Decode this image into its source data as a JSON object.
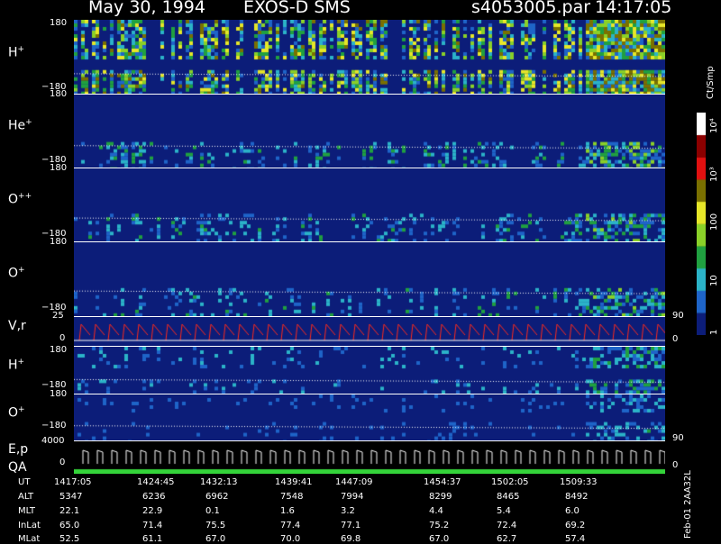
{
  "header": {
    "date": "May 30, 1994",
    "instrument": "EXOS-D SMS",
    "file": "s4053005.par",
    "time": "14:17:05"
  },
  "colorbar": {
    "unit": "Ct/Smp",
    "ticks": [
      "1",
      "10",
      "100",
      "10³",
      "10⁴"
    ],
    "colors": [
      "#0c1d79",
      "#1e64c8",
      "#2bb3c8",
      "#20a040",
      "#8ad028",
      "#e6e628",
      "#7a7000",
      "#e01010",
      "#8b0000",
      "#ffffff"
    ]
  },
  "footer_label": "Feb-01 2AA32L",
  "panels": [
    {
      "name": "H",
      "sup": "+",
      "ytop": "180",
      "ybot": "−180"
    },
    {
      "name": "He",
      "sup": "+",
      "ytop": "180",
      "ybot": "−180"
    },
    {
      "name": "O",
      "sup": "++",
      "ytop": "180",
      "ybot": "−180"
    },
    {
      "name": "O",
      "sup": "+",
      "ytop": "180",
      "ybot": "−180"
    },
    {
      "name": "V,r",
      "sup": "",
      "ytop": "25",
      "ybot": "0",
      "rtop": "90",
      "rbot": "0"
    },
    {
      "name": "H",
      "sup": "+",
      "ytop": "180",
      "ybot": "−180"
    },
    {
      "name": "O",
      "sup": "+",
      "ytop": "180",
      "ybot": "−180"
    },
    {
      "name": "E,p",
      "sup": "",
      "ytop": "4000",
      "ybot": "",
      "rtop": "90",
      "rbot": ""
    },
    {
      "name": "QA",
      "sup": "",
      "ytop": "0",
      "ybot": "",
      "rtop": "0",
      "rbot": ""
    }
  ],
  "ephemeris": {
    "rows": [
      {
        "label": "UT",
        "values": [
          "1417:05",
          "1424:45",
          "1432:13",
          "1439:41",
          "1447:09",
          "1454:37",
          "1502:05",
          "1509:33"
        ]
      },
      {
        "label": "ALT",
        "values": [
          "5347",
          "6236",
          "6962",
          "7548",
          "7994",
          "8299",
          "8465",
          "8492"
        ]
      },
      {
        "label": "MLT",
        "values": [
          "22.1",
          "22.9",
          "0.1",
          "1.6",
          "3.2",
          "4.4",
          "5.4",
          "6.0"
        ]
      },
      {
        "label": "InLat",
        "values": [
          "65.0",
          "71.4",
          "75.5",
          "77.4",
          "77.1",
          "75.2",
          "72.4",
          "69.2"
        ]
      },
      {
        "label": "MLat",
        "values": [
          "52.5",
          "61.1",
          "67.0",
          "70.0",
          "69.8",
          "67.0",
          "62.7",
          "57.4"
        ]
      }
    ]
  },
  "chart_data": {
    "type": "heatmap",
    "x_ticks_ut": [
      "1417:05",
      "1424:45",
      "1432:13",
      "1439:41",
      "1447:09",
      "1454:37",
      "1502:05",
      "1509:33"
    ],
    "y_range_pitch": [
      -180,
      180
    ],
    "color_scale": "log",
    "color_range": [
      1,
      10000
    ],
    "series": [
      {
        "name": "H+",
        "y_range": [
          -180,
          180
        ]
      },
      {
        "name": "He+",
        "y_range": [
          -180,
          180
        ]
      },
      {
        "name": "O++",
        "y_range": [
          -180,
          180
        ]
      },
      {
        "name": "O+",
        "y_range": [
          -180,
          180
        ]
      },
      {
        "name": "V,r",
        "y_range": [
          0,
          25
        ],
        "right_range": [
          0,
          90
        ]
      },
      {
        "name": "H+",
        "y_range": [
          -180,
          180
        ]
      },
      {
        "name": "O+",
        "y_range": [
          -180,
          180
        ]
      },
      {
        "name": "E,p",
        "y_range": [
          0,
          4000
        ],
        "right_range": [
          0,
          90
        ]
      },
      {
        "name": "QA",
        "y_range": [
          0,
          0
        ],
        "right_range": [
          0,
          0
        ]
      }
    ]
  }
}
